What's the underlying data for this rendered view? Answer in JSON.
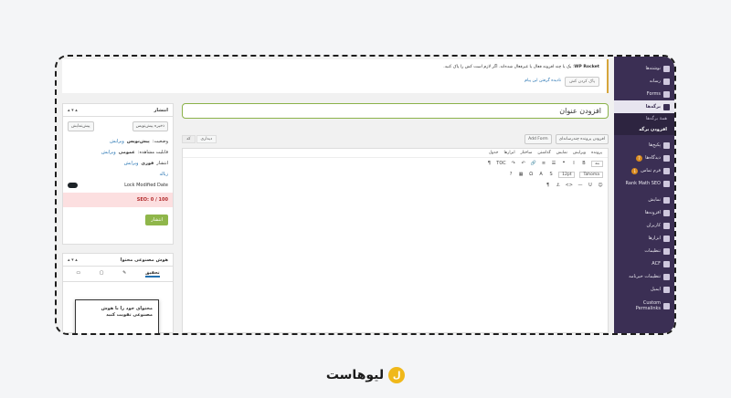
{
  "sidebar": {
    "items": [
      {
        "label": "نوشته‌ها",
        "icon": "pin-icon"
      },
      {
        "label": "رسانه",
        "icon": "media-icon"
      },
      {
        "label": "Forms",
        "icon": "forms-icon"
      },
      {
        "label": "برگه‌ها",
        "icon": "pages-icon"
      },
      {
        "label": "همهٔ برگه‌ها"
      },
      {
        "label": "افزودن برگه"
      },
      {
        "label": "پکیج‌ها",
        "icon": "package-icon"
      },
      {
        "label": "دیدگاه‌ها",
        "icon": "comments-icon",
        "badge": "7"
      },
      {
        "label": "فرم تماس",
        "icon": "mail-icon",
        "badge": "1"
      },
      {
        "label": "Rank Math SEO",
        "icon": "rankmath-icon"
      },
      {
        "label": "نمایش",
        "icon": "appearance-icon"
      },
      {
        "label": "افزونه‌ها",
        "icon": "plugins-icon"
      },
      {
        "label": "کاربران",
        "icon": "users-icon"
      },
      {
        "label": "ابزارها",
        "icon": "tools-icon"
      },
      {
        "label": "تنظیمات",
        "icon": "settings-icon"
      },
      {
        "label": "ACF",
        "icon": "acf-icon"
      },
      {
        "label": "تنظیمات خبرنامه",
        "icon": "newsletter-icon"
      },
      {
        "label": "ایمیل",
        "icon": "email-icon"
      },
      {
        "label": "Custom Permalinks",
        "icon": "link-icon"
      }
    ]
  },
  "notice": {
    "brand": "WP Rocket",
    "text": ": یک یا چند افزونه فعال یا غیرفعال شده‌اند. اگر لازم است کش را پاک کنید.",
    "btn_clear": "پاک کردن کش",
    "btn_dismiss": "نادیده گرفتن این پیام"
  },
  "title": {
    "placeholder": "افزودن عنوان"
  },
  "editor": {
    "add_media": "افزودن پرونده چندرسانه‌ای",
    "add_form": "Add Form",
    "tab_visual": "دیداری",
    "tab_code": "کد",
    "menu": [
      "پرونده",
      "ویرایش",
      "نمایش",
      "گذاشتن",
      "ساختار",
      "ابزارها",
      "جدول"
    ],
    "font": "Tahoma",
    "size": "12pt",
    "block": "بند"
  },
  "publish": {
    "title": "انتشار",
    "save_draft": "ذخیره پیش‌نویس",
    "preview": "پیش‌نمایش",
    "status_label": "وضعیت:",
    "status_value": "پیش‌نویس",
    "edit": "ویرایش",
    "visibility_label": "قابلیت مشاهده:",
    "visibility_value": "عمومی",
    "publish_now_label": "انتشار",
    "publish_now_value": "فوری",
    "trash": "زباله",
    "lock_label": "Lock Modified Date",
    "seo": "SEO: 0 / 100",
    "publish_btn": "انتشار"
  },
  "ai": {
    "title": "هوش مصنوعی محتوا",
    "tab_research": "تحقیق",
    "popup": "محتوای خود را با هوش مصنوعی تقویت کنید"
  },
  "logo": {
    "text": "لیوهاست"
  }
}
